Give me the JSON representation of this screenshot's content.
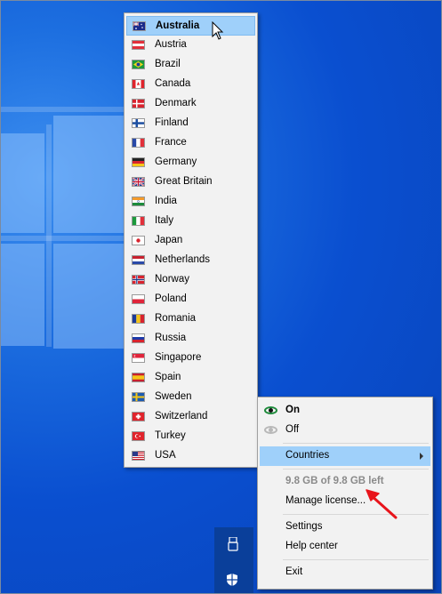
{
  "countries_menu": {
    "items": [
      {
        "label": "Australia",
        "flag": "australia-flag",
        "selected": true
      },
      {
        "label": "Austria",
        "flag": "austria-flag"
      },
      {
        "label": "Brazil",
        "flag": "brazil-flag"
      },
      {
        "label": "Canada",
        "flag": "canada-flag"
      },
      {
        "label": "Denmark",
        "flag": "denmark-flag"
      },
      {
        "label": "Finland",
        "flag": "finland-flag"
      },
      {
        "label": "France",
        "flag": "france-flag"
      },
      {
        "label": "Germany",
        "flag": "germany-flag"
      },
      {
        "label": "Great Britain",
        "flag": "great-britain-flag"
      },
      {
        "label": "India",
        "flag": "india-flag"
      },
      {
        "label": "Italy",
        "flag": "italy-flag"
      },
      {
        "label": "Japan",
        "flag": "japan-flag"
      },
      {
        "label": "Netherlands",
        "flag": "netherlands-flag"
      },
      {
        "label": "Norway",
        "flag": "norway-flag"
      },
      {
        "label": "Poland",
        "flag": "poland-flag"
      },
      {
        "label": "Romania",
        "flag": "romania-flag"
      },
      {
        "label": "Russia",
        "flag": "russia-flag"
      },
      {
        "label": "Singapore",
        "flag": "singapore-flag"
      },
      {
        "label": "Spain",
        "flag": "spain-flag"
      },
      {
        "label": "Sweden",
        "flag": "sweden-flag"
      },
      {
        "label": "Switzerland",
        "flag": "switzerland-flag"
      },
      {
        "label": "Turkey",
        "flag": "turkey-flag"
      },
      {
        "label": "USA",
        "flag": "usa-flag"
      }
    ]
  },
  "tray_menu": {
    "on_label": "On",
    "off_label": "Off",
    "countries_label": "Countries",
    "data_left": "9.8 GB of 9.8 GB left",
    "manage_license": "Manage license...",
    "settings": "Settings",
    "help_center": "Help center",
    "exit": "Exit"
  },
  "colors": {
    "highlight": "#9fd0fa",
    "desktop": "#0a4fd0",
    "annotation": "#e8141b"
  }
}
